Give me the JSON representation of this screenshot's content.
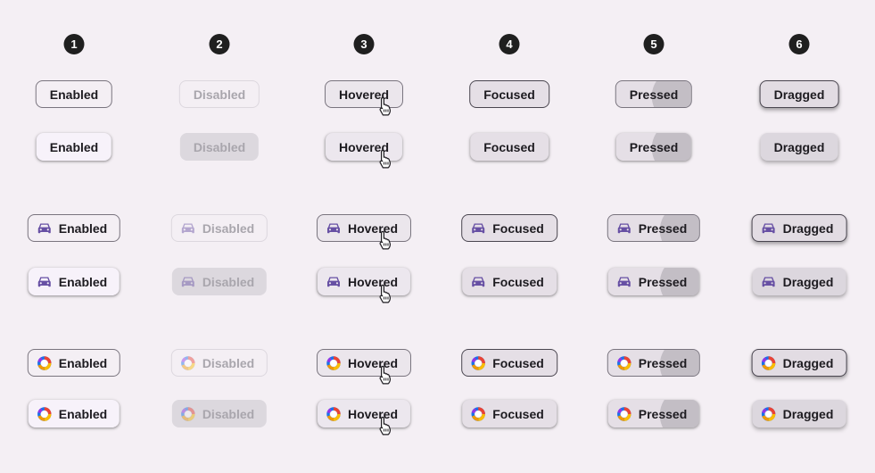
{
  "columns": [
    {
      "number": "1",
      "state": "enabled",
      "label": "Enabled"
    },
    {
      "number": "2",
      "state": "disabled",
      "label": "Disabled"
    },
    {
      "number": "3",
      "state": "hovered",
      "label": "Hovered"
    },
    {
      "number": "4",
      "state": "focused",
      "label": "Focused"
    },
    {
      "number": "5",
      "state": "pressed",
      "label": "Pressed"
    },
    {
      "number": "6",
      "state": "dragged",
      "label": "Dragged"
    }
  ],
  "rows": [
    {
      "variant": "outlined",
      "icon": null
    },
    {
      "variant": "elevated",
      "icon": null
    },
    {
      "variant": "outlined",
      "icon": "car-icon"
    },
    {
      "variant": "elevated",
      "icon": "car-icon"
    },
    {
      "variant": "outlined",
      "icon": "avatar-ring-icon"
    },
    {
      "variant": "elevated",
      "icon": "avatar-ring-icon"
    }
  ],
  "colors": {
    "background": "#f4eff4",
    "icon_primary": "#6750a4",
    "outline": "#79747e"
  }
}
